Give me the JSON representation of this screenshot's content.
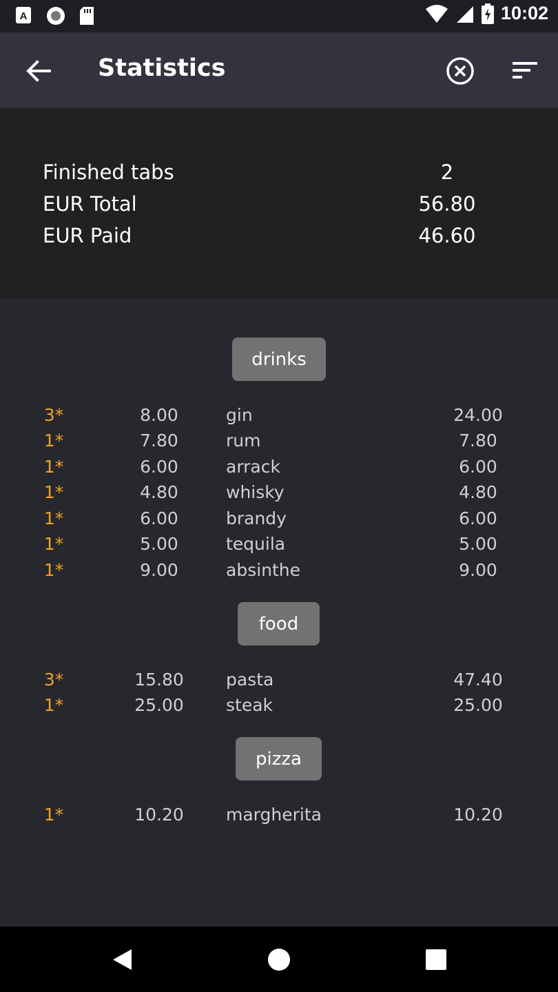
{
  "status_bar": {
    "time": "10:02",
    "left_icons": [
      "accessibility-icon",
      "record-icon",
      "sd-card-icon"
    ],
    "right_icons": [
      "wifi-icon",
      "cellular-signal-icon",
      "battery-charging-icon"
    ]
  },
  "app_bar": {
    "title": "Statistics",
    "icons": [
      "arrow-back-icon",
      "close-circle-icon",
      "sort-icon"
    ]
  },
  "summary": {
    "rows": [
      {
        "label": "Finished tabs",
        "value": "2"
      },
      {
        "label": "EUR Total",
        "value": "56.80"
      },
      {
        "label": "EUR Paid",
        "value": "46.60"
      }
    ]
  },
  "categories": [
    {
      "label": "drinks",
      "items": [
        {
          "qty": "3*",
          "unit": "8.00",
          "name": "gin",
          "total": "24.00"
        },
        {
          "qty": "1*",
          "unit": "7.80",
          "name": "rum",
          "total": "7.80"
        },
        {
          "qty": "1*",
          "unit": "6.00",
          "name": "arrack",
          "total": "6.00"
        },
        {
          "qty": "1*",
          "unit": "4.80",
          "name": "whisky",
          "total": "4.80"
        },
        {
          "qty": "1*",
          "unit": "6.00",
          "name": "brandy",
          "total": "6.00"
        },
        {
          "qty": "1*",
          "unit": "5.00",
          "name": "tequila",
          "total": "5.00"
        },
        {
          "qty": "1*",
          "unit": "9.00",
          "name": "absinthe",
          "total": "9.00"
        }
      ]
    },
    {
      "label": "food",
      "items": [
        {
          "qty": "3*",
          "unit": "15.80",
          "name": "pasta",
          "total": "47.40"
        },
        {
          "qty": "1*",
          "unit": "25.00",
          "name": "steak",
          "total": "25.00"
        }
      ]
    },
    {
      "label": "pizza",
      "items": [
        {
          "qty": "1*",
          "unit": "10.20",
          "name": "margherita",
          "total": "10.20"
        }
      ]
    }
  ],
  "nav_bar": {
    "icons": [
      "back-triangle-icon",
      "home-circle-icon",
      "recents-square-icon"
    ]
  },
  "colors": {
    "quantity": "#f0a127",
    "app_bar": "#32333e",
    "summary_bg": "#212124",
    "list_bg": "#27282e",
    "category_button": "#727272"
  }
}
